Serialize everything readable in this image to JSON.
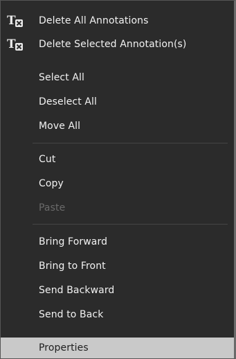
{
  "menu": {
    "items": [
      {
        "label": "Delete All Annotations",
        "icon": "delete-annotations-icon"
      },
      {
        "label": "Delete Selected Annotation(s)",
        "icon": "delete-annotations-icon"
      },
      {
        "label": "Select All"
      },
      {
        "label": "Deselect All"
      },
      {
        "label": "Move All"
      },
      {
        "label": "Cut"
      },
      {
        "label": "Copy"
      },
      {
        "label": "Paste",
        "disabled": true
      },
      {
        "label": "Bring Forward"
      },
      {
        "label": "Bring to Front"
      },
      {
        "label": "Send Backward"
      },
      {
        "label": "Send to Back"
      },
      {
        "label": "Properties",
        "highlighted": true
      }
    ]
  },
  "colors": {
    "background": "#2b2b2b",
    "text": "#f2f2f2",
    "disabled_text": "#6a6a6a",
    "highlight": "#c9c9c9",
    "separator": "#454545"
  }
}
